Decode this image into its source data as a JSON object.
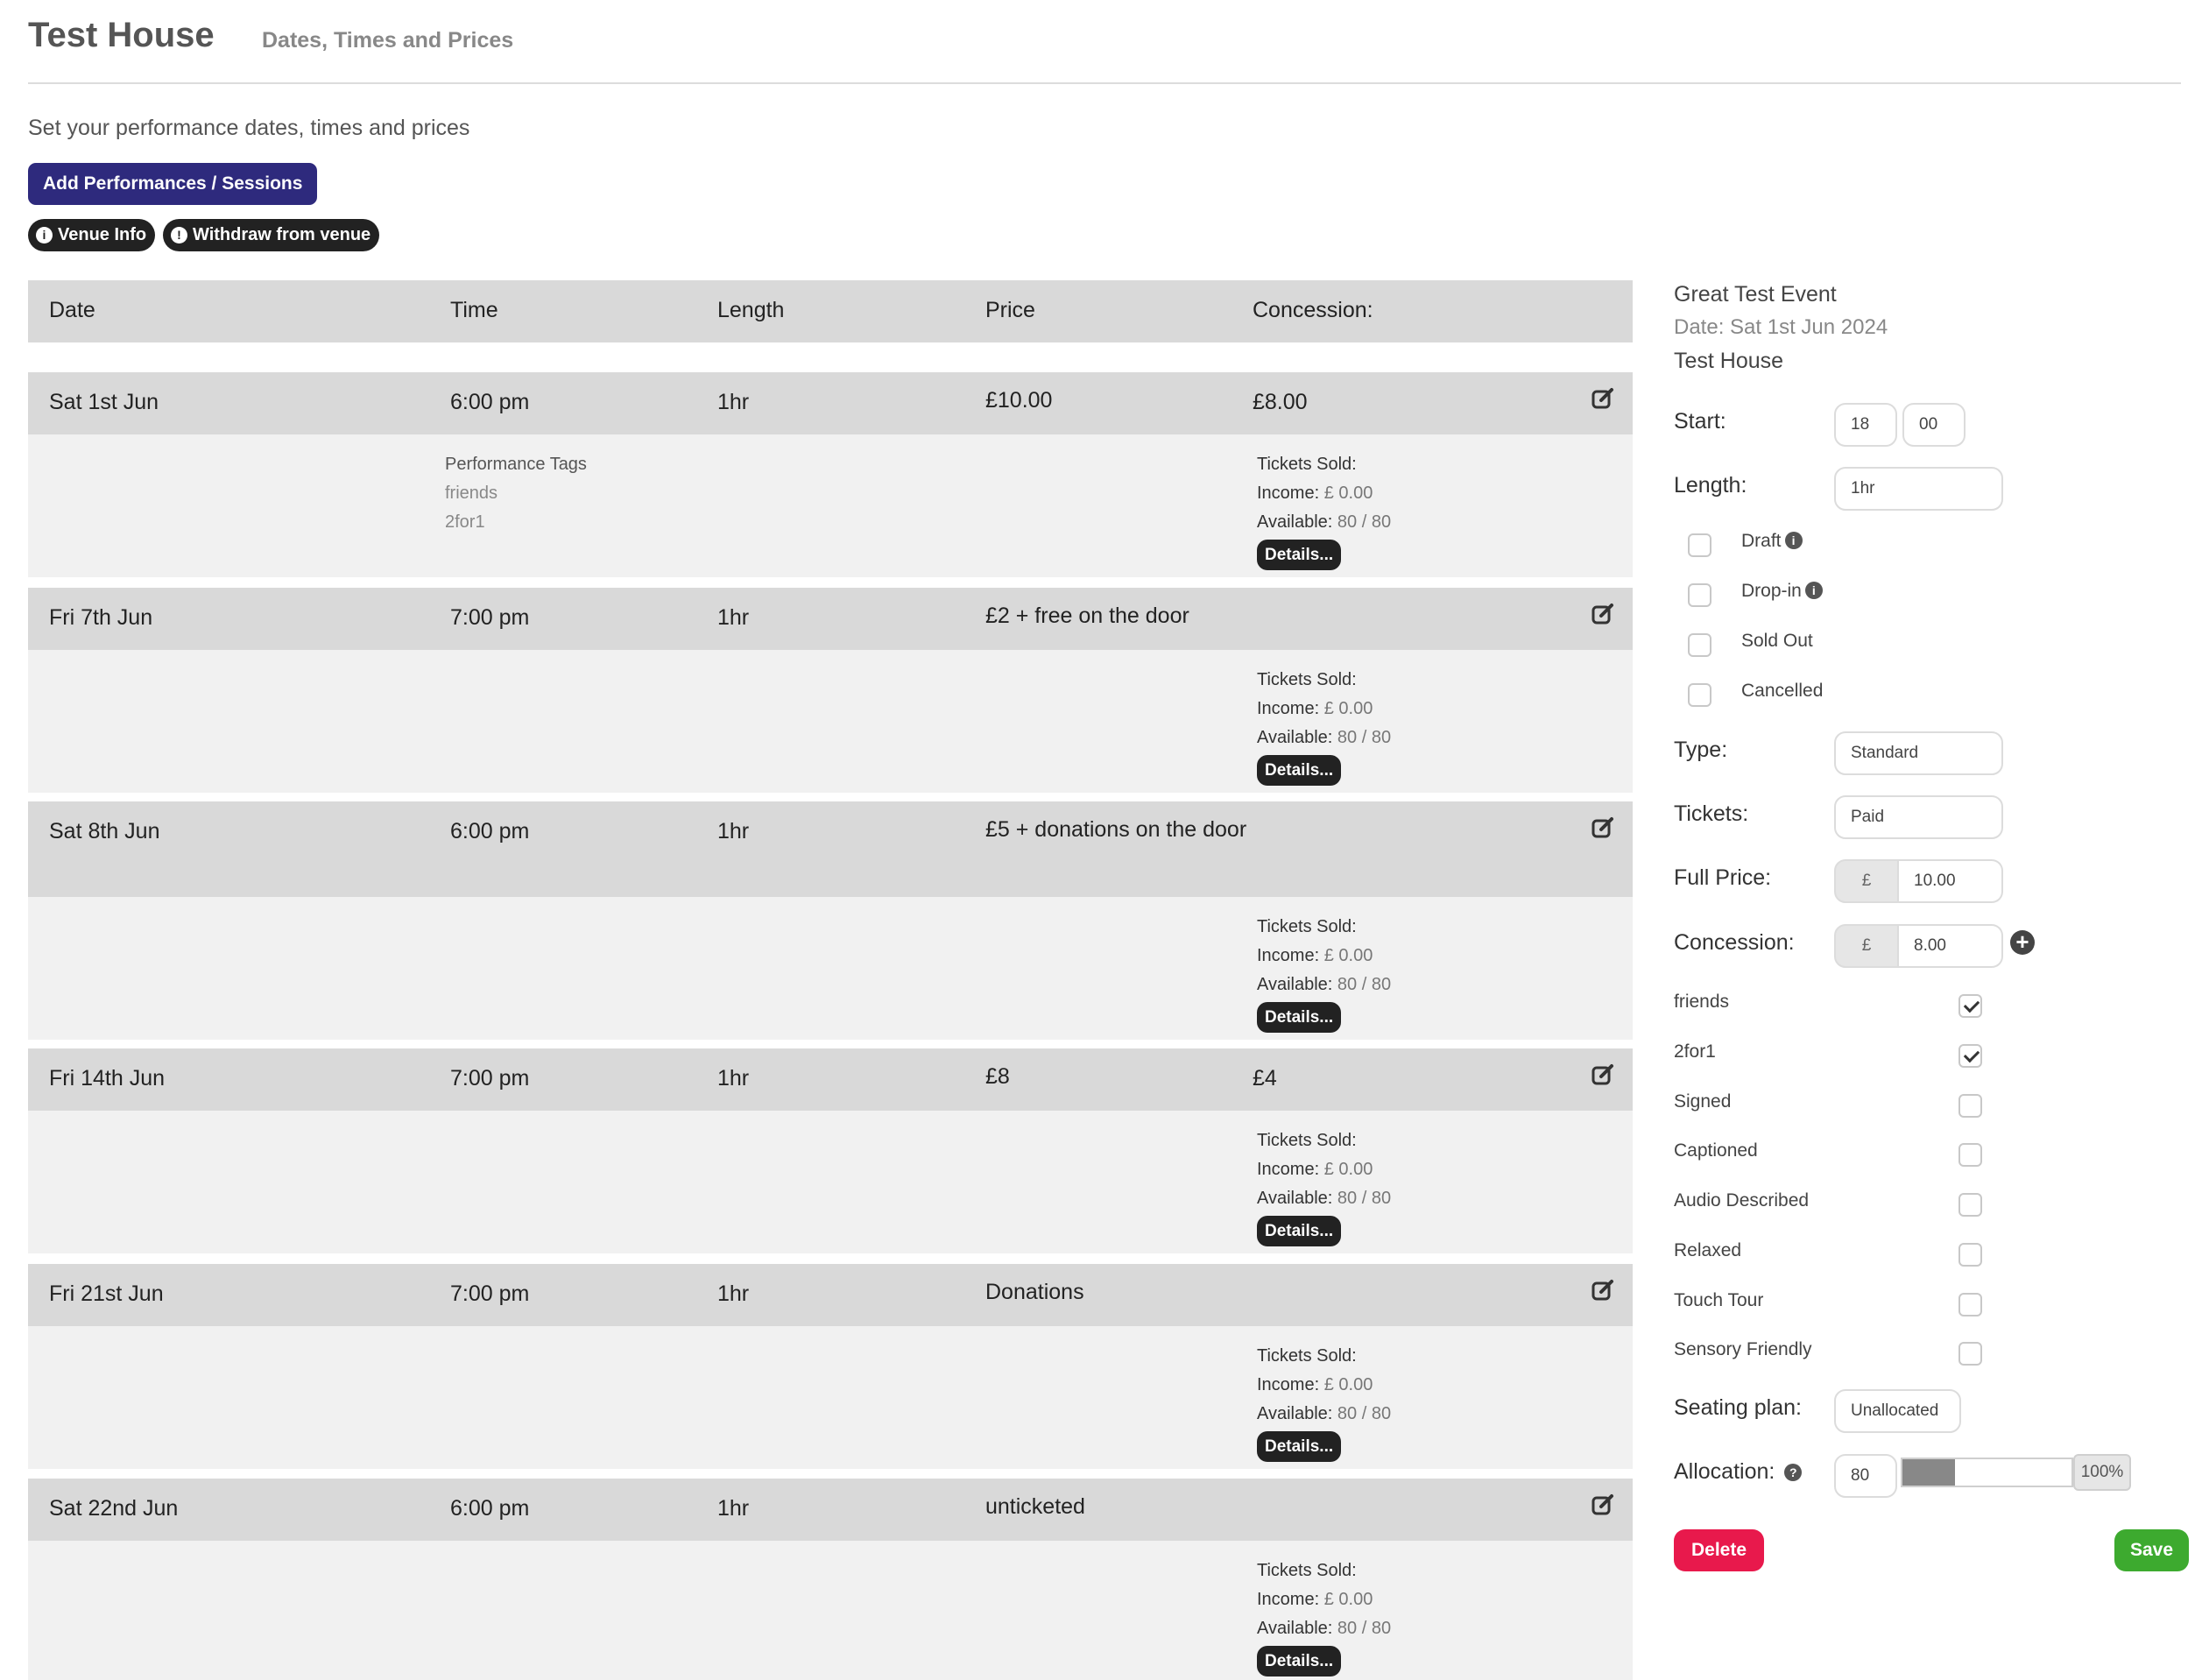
{
  "header": {
    "title": "Test House",
    "subtitle": "Dates, Times and Prices"
  },
  "intro": "Set your performance dates, times and prices",
  "buttons": {
    "add_label": "Add Performances / Sessions",
    "venue_info": "Venue Info",
    "withdraw": "Withdraw from venue"
  },
  "table": {
    "columns": {
      "date": "Date",
      "time": "Time",
      "length": "Length",
      "price": "Price",
      "concession": "Concession:"
    },
    "stats_labels": {
      "sold": "Tickets Sold:",
      "income": "Income:",
      "available": "Available:",
      "details": "Details..."
    },
    "tags_heading": "Performance Tags",
    "rows": [
      {
        "date": "Sat 1st Jun",
        "time": "6:00 pm",
        "length": "1hr",
        "price": "£10.00",
        "concession": "£8.00",
        "tags": [
          "friends",
          "2for1"
        ],
        "income": "£ 0.00",
        "available": "80 / 80"
      },
      {
        "date": "Fri 7th Jun",
        "time": "7:00 pm",
        "length": "1hr",
        "price": "£2 + free on the door",
        "concession": "",
        "tags": [],
        "income": "£ 0.00",
        "available": "80 / 80"
      },
      {
        "date": "Sat 8th Jun",
        "time": "6:00 pm",
        "length": "1hr",
        "price": "£5 + donations on the door",
        "concession": "",
        "tags": [],
        "income": "£ 0.00",
        "available": "80 / 80"
      },
      {
        "date": "Fri 14th Jun",
        "time": "7:00 pm",
        "length": "1hr",
        "price": "£8",
        "concession": "£4",
        "tags": [],
        "income": "£ 0.00",
        "available": "80 / 80"
      },
      {
        "date": "Fri 21st Jun",
        "time": "7:00 pm",
        "length": "1hr",
        "price": "Donations",
        "concession": "",
        "tags": [],
        "income": "£ 0.00",
        "available": "80 / 80"
      },
      {
        "date": "Sat 22nd Jun",
        "time": "6:00 pm",
        "length": "1hr",
        "price": "unticketed",
        "concession": "",
        "tags": [],
        "income": "£ 0.00",
        "available": "80 / 80"
      }
    ]
  },
  "editor": {
    "event_title": "Great Test Event",
    "event_date": "Date: Sat 1st Jun 2024",
    "venue": "Test House",
    "start_label": "Start:",
    "start_hour": "18",
    "start_min": "00",
    "length_label": "Length:",
    "length_value": "1hr",
    "flags": [
      {
        "label": "Draft",
        "info": true,
        "checked": false
      },
      {
        "label": "Drop-in",
        "info": true,
        "checked": false
      },
      {
        "label": "Sold Out",
        "info": false,
        "checked": false
      },
      {
        "label": "Cancelled",
        "info": false,
        "checked": false
      }
    ],
    "type_label": "Type:",
    "type_value": "Standard",
    "tickets_label": "Tickets:",
    "tickets_value": "Paid",
    "full_price_label": "Full Price:",
    "currency": "£",
    "full_price_value": "10.00",
    "concession_label": "Concession:",
    "concession_value": "8.00",
    "tags": [
      {
        "label": "friends",
        "checked": true
      },
      {
        "label": "2for1",
        "checked": true
      },
      {
        "label": "Signed",
        "checked": false
      },
      {
        "label": "Captioned",
        "checked": false
      },
      {
        "label": "Audio Described",
        "checked": false
      },
      {
        "label": "Relaxed",
        "checked": false
      },
      {
        "label": "Touch Tour",
        "checked": false
      },
      {
        "label": "Sensory Friendly",
        "checked": false
      }
    ],
    "seating_label": "Seating plan:",
    "seating_value": "Unallocated",
    "allocation_label": "Allocation:",
    "allocation_value": "80",
    "allocation_percent": "100%",
    "allocation_fill_fraction": 0.31,
    "delete_label": "Delete",
    "save_label": "Save"
  },
  "colors": {
    "primary": "#2e2a7d",
    "delete": "#e8194c",
    "save": "#3daa2f",
    "row_head": "#d9d9d9",
    "row_body": "#f1f1f1"
  }
}
